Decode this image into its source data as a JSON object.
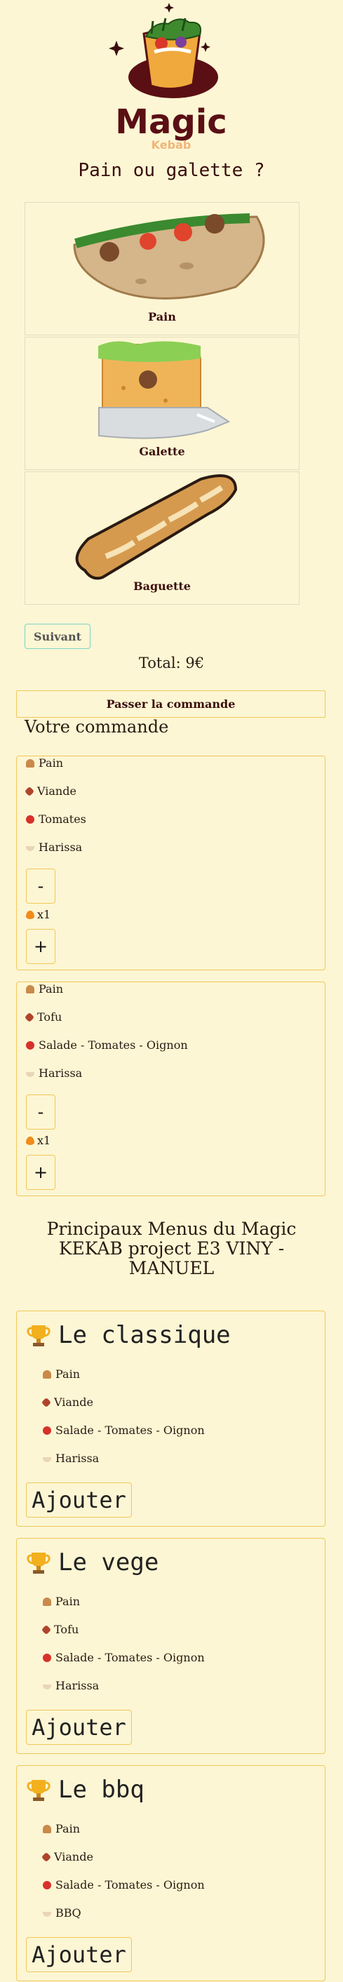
{
  "logo": {
    "title": "Magic",
    "subtitle": "Kebab"
  },
  "question": "Pain ou galette ?",
  "choices": [
    {
      "label": "Pain"
    },
    {
      "label": "Galette"
    },
    {
      "label": "Baguette"
    }
  ],
  "suivant_label": "Suivant",
  "total": "Total: 9€",
  "passer_label": "Passer la commande",
  "votre_commande": "Votre commande",
  "orders": [
    {
      "items": [
        {
          "icon": "bread-icon",
          "label": "Pain"
        },
        {
          "icon": "meat-icon",
          "label": "Viande"
        },
        {
          "icon": "tomato-icon",
          "label": "Tomates"
        },
        {
          "icon": "sauce-icon",
          "label": "Harissa"
        }
      ],
      "minus": "-",
      "plus": "+",
      "quantity": "x1"
    },
    {
      "items": [
        {
          "icon": "bread-icon",
          "label": "Pain"
        },
        {
          "icon": "meat-icon",
          "label": "Tofu"
        },
        {
          "icon": "tomato-icon",
          "label": "Salade - Tomates - Oignon"
        },
        {
          "icon": "sauce-icon",
          "label": "Harissa"
        }
      ],
      "minus": "-",
      "plus": "+",
      "quantity": "x1"
    }
  ],
  "menus_title": "Principaux Menus du Magic KEKAB project E3 VINY - MANUEL",
  "menus": [
    {
      "title": "Le classique",
      "items": [
        {
          "icon": "bread-icon",
          "label": "Pain"
        },
        {
          "icon": "meat-icon",
          "label": "Viande"
        },
        {
          "icon": "tomato-icon",
          "label": "Salade - Tomates - Oignon"
        },
        {
          "icon": "sauce-icon",
          "label": "Harissa"
        }
      ],
      "button": "Ajouter"
    },
    {
      "title": "Le vege",
      "items": [
        {
          "icon": "bread-icon",
          "label": "Pain"
        },
        {
          "icon": "meat-icon",
          "label": "Tofu"
        },
        {
          "icon": "tomato-icon",
          "label": "Salade - Tomates - Oignon"
        },
        {
          "icon": "sauce-icon",
          "label": "Harissa"
        }
      ],
      "button": "Ajouter"
    },
    {
      "title": "Le bbq",
      "items": [
        {
          "icon": "bread-icon",
          "label": "Pain"
        },
        {
          "icon": "meat-icon",
          "label": "Viande"
        },
        {
          "icon": "tomato-icon",
          "label": "Salade - Tomates - Oignon"
        },
        {
          "icon": "sauce-icon",
          "label": "BBQ"
        }
      ],
      "button": "Ajouter"
    }
  ],
  "colors": {
    "accent": "#f0c75a",
    "brand": "#5a0f14",
    "background": "#fdf6d4",
    "suivant_border": "#7dd3c6"
  }
}
